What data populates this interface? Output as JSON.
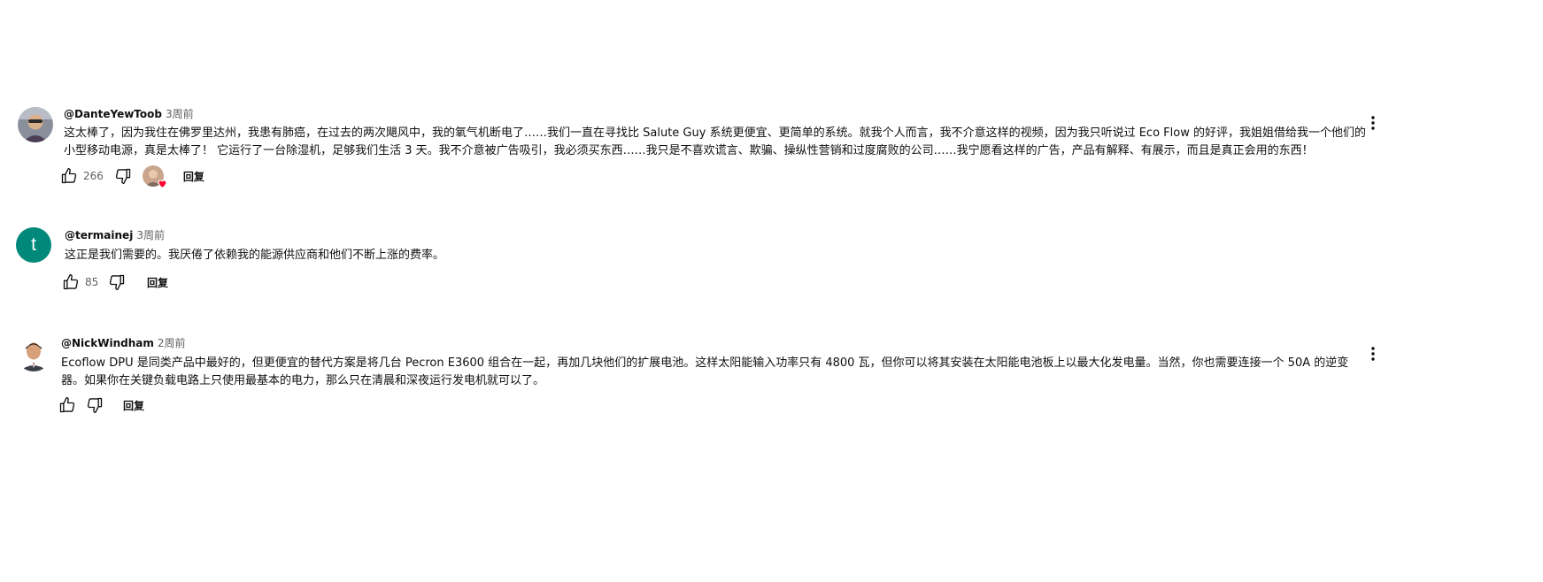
{
  "comments": [
    {
      "author": "@DanteYewToob",
      "time": "3周前",
      "avatar_icon": "user-photo-avatar",
      "lines": [
        "这太棒了，因为我住在佛罗里达州，我患有肺癌，在过去的两次飓风中，我的氧气机断电了……我们一直在寻找比 Salute Guy 系统更便宜、更简单的系统。就我个人而言，我不介意这样的视频，因为我只听说过 Eco Flow 的好评，我姐姐借给我一个他们的",
        "小型移动电源，真是太棒了！ 它运行了一台除湿机，足够我们生活 3 天。我不介意被广告吸引，我必须买东西……我只是不喜欢谎言、欺骗、操纵性营销和过度腐败的公司……我宁愿看这样的广告，产品有解释、有展示，而且是真正会用的东西！"
      ],
      "likes": "266",
      "creator_hearted": true,
      "reply_label": "回复"
    },
    {
      "author": "@termainej",
      "time": "3周前",
      "avatar_letter": "t",
      "avatar_color": "#00897b",
      "lines": [
        "这正是我们需要的。我厌倦了依赖我的能源供应商和他们不断上涨的费率。"
      ],
      "likes": "85",
      "creator_hearted": false,
      "reply_label": "回复"
    },
    {
      "author": "@NickWindham",
      "time": "2周前",
      "avatar_icon": "user-photo-avatar",
      "lines": [
        "Ecoflow DPU 是同类产品中最好的，但更便宜的替代方案是将几台 Pecron E3600 组合在一起，再加几块他们的扩展电池。这样太阳能输入功率只有 4800 瓦，但你可以将其安装在太阳能电池板上以最大化发电量。当然，你也需要连接一个 50A 的逆变",
        "器。如果你在关键负载电路上只使用最基本的电力，那么只在清晨和深夜运行发电机就可以了。"
      ],
      "likes": "",
      "creator_hearted": false,
      "reply_label": "回复"
    }
  ],
  "icons": {
    "like": "thumb-up-icon",
    "dislike": "thumb-down-icon",
    "more": "more-vert-icon",
    "heart": "heart-icon"
  },
  "colors": {
    "text": "#0f0f0f",
    "secondary": "#606060",
    "heart": "#ff0033",
    "avatar_teal": "#00897b"
  }
}
